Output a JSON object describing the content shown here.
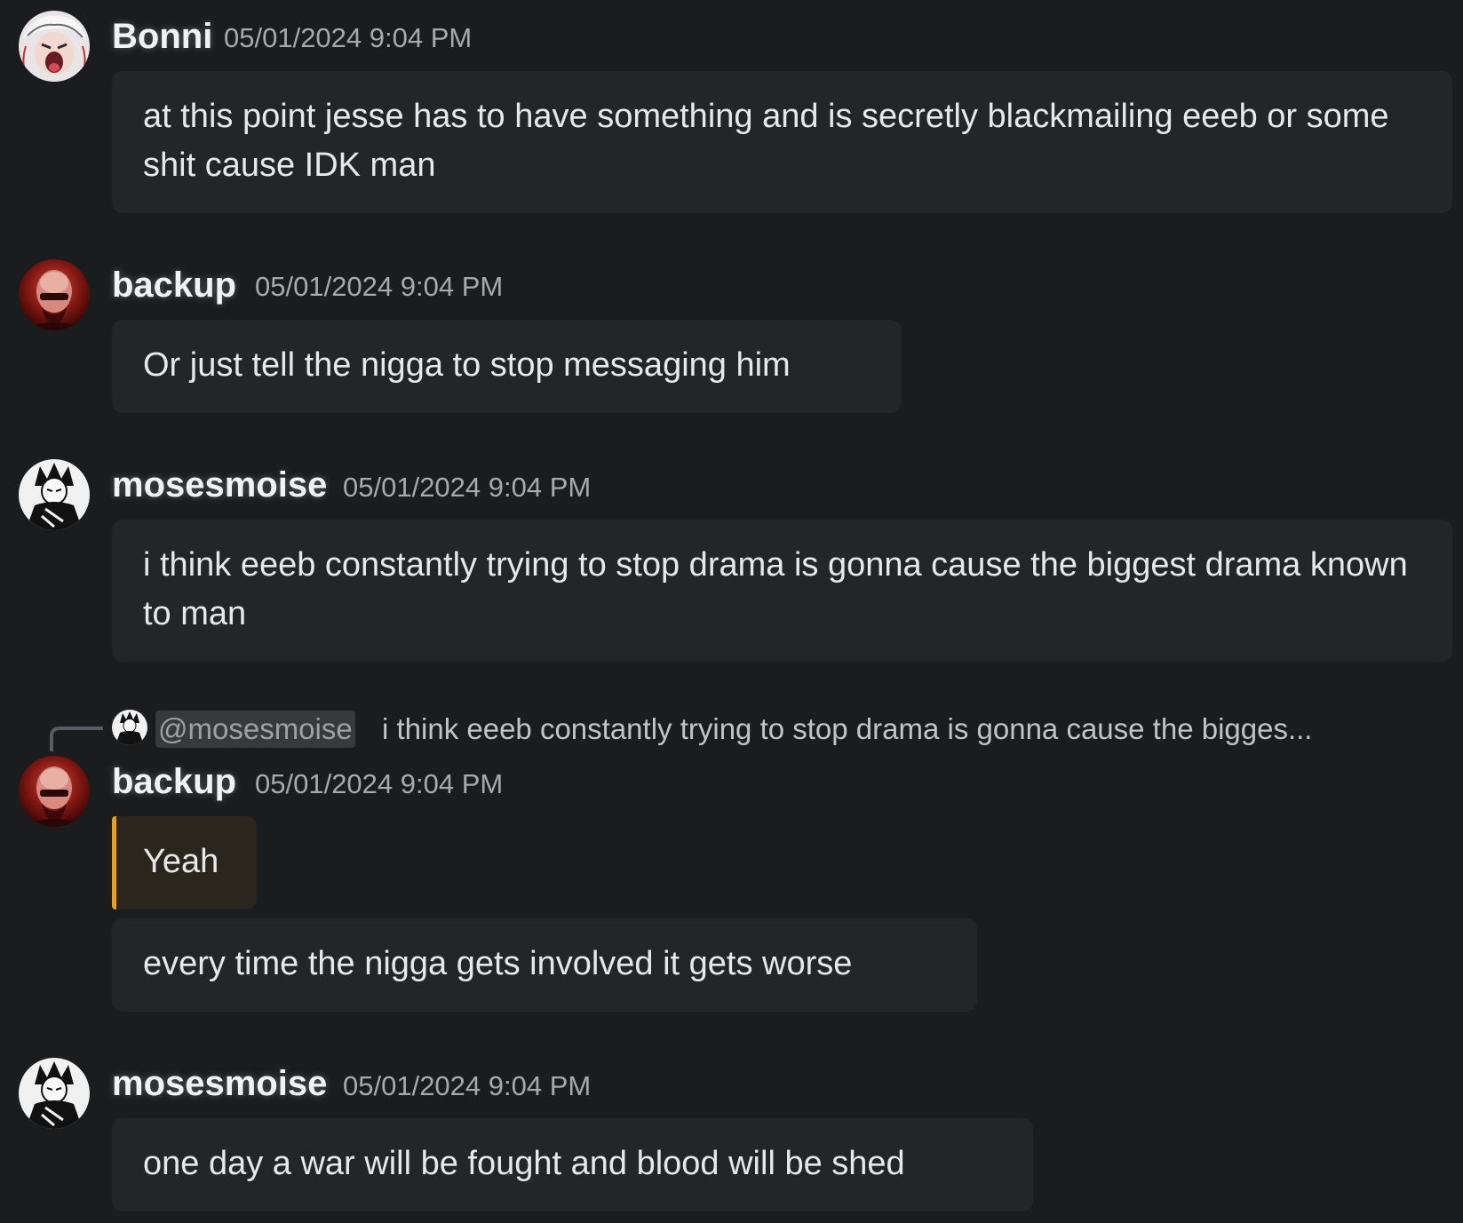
{
  "messages": [
    {
      "author": "Bonni",
      "timestamp": "05/01/2024 9:04 PM",
      "avatar_icon": "anime-avatar-white-hair-icon",
      "lines": [
        "at this point jesse has to have something and is secretly blackmailing eeeb or some shit cause IDK man"
      ]
    },
    {
      "author": "backup",
      "timestamp": "05/01/2024 9:04 PM",
      "avatar_icon": "red-bald-man-avatar-icon",
      "lines": [
        "Or just tell the nigga to stop messaging him"
      ]
    },
    {
      "author": "mosesmoise",
      "timestamp": "05/01/2024 9:04 PM",
      "avatar_icon": "manga-avatar-black-white-icon",
      "lines": [
        "i think eeeb constantly trying to stop drama is gonna cause the biggest drama known to man"
      ]
    },
    {
      "author": "backup",
      "timestamp": "05/01/2024 9:04 PM",
      "avatar_icon": "red-bald-man-avatar-icon",
      "reply_to": {
        "mention": "@mosesmoise",
        "preview": "i think eeeb constantly trying to stop drama is gonna cause the bigges..."
      },
      "lines": [
        "Yeah",
        "every time the nigga gets involved it gets worse"
      ]
    },
    {
      "author": "mosesmoise",
      "timestamp": "05/01/2024 9:04 PM",
      "avatar_icon": "manga-avatar-black-white-icon",
      "lines": [
        "one day a war will be fought and blood will be shed"
      ]
    }
  ],
  "colors": {
    "background": "#1b1c1e",
    "bubble": "#242527",
    "reply_highlight_bubble": "#2b261d",
    "reply_highlight_bar": "#e0a22a",
    "timestamp": "#a7a9ad"
  }
}
